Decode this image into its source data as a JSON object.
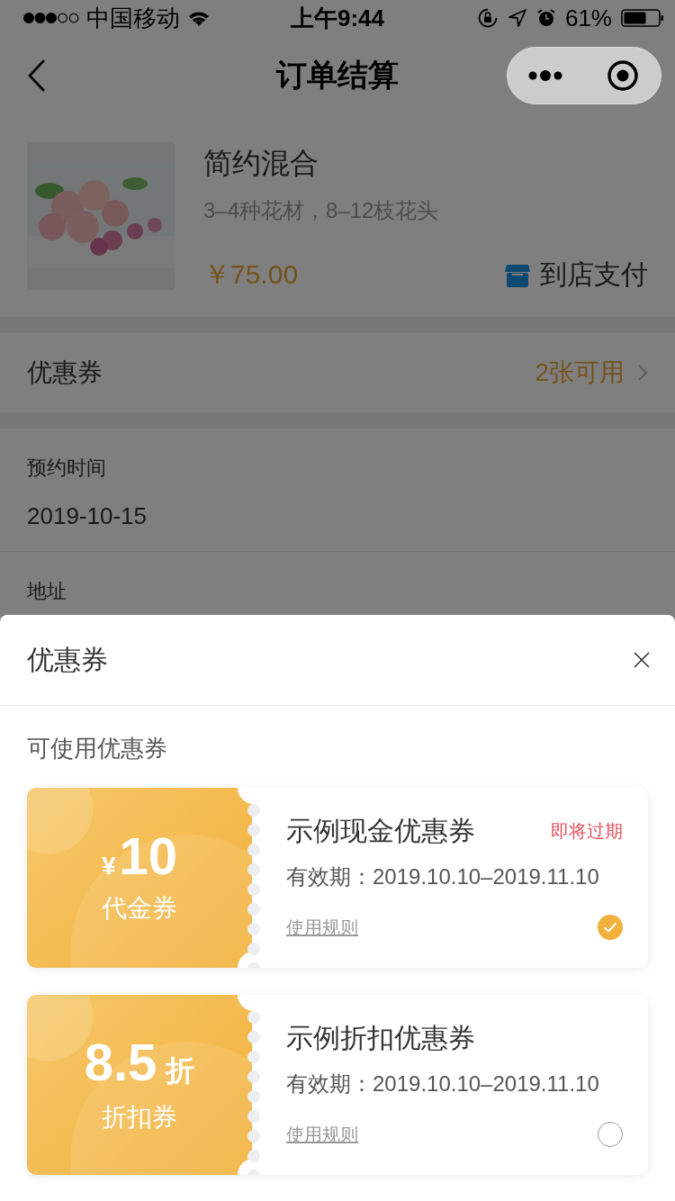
{
  "status_bar": {
    "carrier": "中国移动",
    "time": "上午9:44",
    "battery": "61%"
  },
  "nav": {
    "title": "订单结算"
  },
  "product": {
    "name": "简约混合",
    "spec": "3–4种花材，8–12枝花头",
    "price": "￥75.00",
    "payment": "到店支付"
  },
  "coupon_row": {
    "label": "优惠券",
    "value": "2张可用"
  },
  "reservation": {
    "label": "预约时间",
    "value": "2019-10-15"
  },
  "address": {
    "label": "地址"
  },
  "sheet": {
    "title": "优惠券",
    "section": "可使用优惠券",
    "coupons": [
      {
        "kind": "cash",
        "currency": "¥",
        "amount": "10",
        "type_label": "代金券",
        "name": "示例现金优惠券",
        "tag": "即将过期",
        "validity": "有效期：2019.10.10–2019.11.10",
        "rules": "使用规则",
        "selected": true
      },
      {
        "kind": "discount",
        "amount": "8.5",
        "unit": "折",
        "type_label": "折扣券",
        "name": "示例折扣优惠券",
        "validity": "有效期：2019.10.10–2019.11.10",
        "rules": "使用规则",
        "selected": false
      }
    ]
  }
}
